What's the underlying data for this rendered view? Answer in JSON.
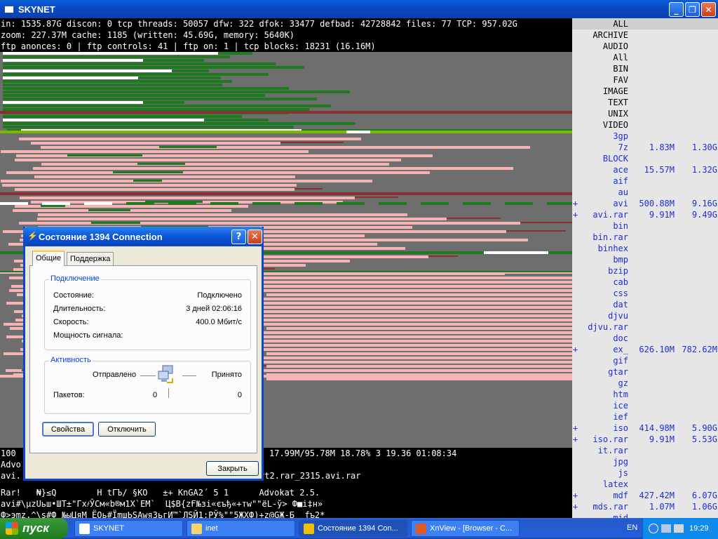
{
  "window": {
    "title": "SKYNET"
  },
  "status": [
    "in: 1535.87G discon: 0 tcp threads: 50057 dfw: 322 dfok: 33477 defbad: 42728842 files: 77 TCP: 957.02G",
    "zoom: 227.37M cache: 1185 (written: 45.69G, memory: 5640K)",
    "ftp anonces: 0 | ftp controls: 41 | ftp on: 1 | tcp blocks: 18231 (16.16M)"
  ],
  "panel": [
    {
      "name": "ALL",
      "kind": "cat",
      "hl": true
    },
    {
      "name": "ARCHIVE",
      "kind": "cat"
    },
    {
      "name": "AUDIO",
      "kind": "cat"
    },
    {
      "name": "All",
      "kind": "cat"
    },
    {
      "name": "BIN",
      "kind": "cat"
    },
    {
      "name": "FAV",
      "kind": "cat"
    },
    {
      "name": "IMAGE",
      "kind": "cat"
    },
    {
      "name": "TEXT",
      "kind": "cat"
    },
    {
      "name": "UNIX",
      "kind": "cat"
    },
    {
      "name": "VIDEO",
      "kind": "cat"
    },
    {
      "name": "3gp",
      "kind": "ext"
    },
    {
      "name": "7z",
      "kind": "ext",
      "s1": "1.83M",
      "s2": "1.30G"
    },
    {
      "name": "BLOCK",
      "kind": "ext"
    },
    {
      "name": "ace",
      "kind": "ext",
      "s1": "15.57M",
      "s2": "1.32G"
    },
    {
      "name": "aif",
      "kind": "ext"
    },
    {
      "name": "au",
      "kind": "ext"
    },
    {
      "name": "avi",
      "kind": "ext",
      "plus": "+",
      "s1": "500.88M",
      "s2": "9.16G"
    },
    {
      "name": "avi.rar",
      "kind": "ext",
      "plus": "+",
      "s1": "9.91M",
      "s2": "9.49G"
    },
    {
      "name": "bin",
      "kind": "ext"
    },
    {
      "name": "bin.rar",
      "kind": "ext"
    },
    {
      "name": "binhex",
      "kind": "ext"
    },
    {
      "name": "bmp",
      "kind": "ext"
    },
    {
      "name": "bzip",
      "kind": "ext"
    },
    {
      "name": "cab",
      "kind": "ext"
    },
    {
      "name": "css",
      "kind": "ext"
    },
    {
      "name": "dat",
      "kind": "ext"
    },
    {
      "name": "djvu",
      "kind": "ext"
    },
    {
      "name": "djvu.rar",
      "kind": "ext"
    },
    {
      "name": "doc",
      "kind": "ext"
    },
    {
      "name": "ex_",
      "kind": "ext",
      "plus": "+",
      "s1": "626.10M",
      "s2": "782.62M"
    },
    {
      "name": "gif",
      "kind": "ext"
    },
    {
      "name": "gtar",
      "kind": "ext"
    },
    {
      "name": "gz",
      "kind": "ext"
    },
    {
      "name": "htm",
      "kind": "ext"
    },
    {
      "name": "ice",
      "kind": "ext"
    },
    {
      "name": "ief",
      "kind": "ext"
    },
    {
      "name": "iso",
      "kind": "ext",
      "plus": "+",
      "s1": "414.98M",
      "s2": "5.90G"
    },
    {
      "name": "iso.rar",
      "kind": "ext",
      "plus": "+",
      "s1": "9.91M",
      "s2": "5.53G"
    },
    {
      "name": "it.rar",
      "kind": "ext"
    },
    {
      "name": "jpg",
      "kind": "ext"
    },
    {
      "name": "js",
      "kind": "ext"
    },
    {
      "name": "latex",
      "kind": "ext"
    },
    {
      "name": "mdf",
      "kind": "ext",
      "plus": "+",
      "s1": "427.42M",
      "s2": "6.07G"
    },
    {
      "name": "mds.rar",
      "kind": "ext",
      "plus": "+",
      "s1": "1.07M",
      "s2": "1.06G"
    },
    {
      "name": "mid",
      "kind": "ext"
    }
  ],
  "console": {
    "line1_left": "100",
    "line1_right": "17.99M/95.78M 18.78% 3 19.36 01:08:34",
    "line2": "Advo",
    "line3_left": "avi.",
    "line3_right": "rt2.rar_2315.avi.rar",
    "line4": "Rar!   ₦}≤Q        H tГЪ/ §KO   ±+ KnGA2´ 5 1      Advokat 2.5.",
    "line5": "avi#\\µzUьш•ШТ±\"Гх҂ЎСм«b®м1X`ЕМ`  Ц$В{zҒ№зі«єъђ«+тw\"\"ёL-ў> Ф■і‡н»",
    "line6": "Ф>эmz.^\\s#Ф №ыЦяМ ЁОь#ЇmшЬSАwяЗьгИ™`ЛSЙ1:РЎ%\"\"5ЖХФ)+z@GЖ-Б  fъ2*"
  },
  "dialog": {
    "title": "Состояние 1394 Connection",
    "tabs": [
      "Общие",
      "Поддержка"
    ],
    "connection_group": "Подключение",
    "rows": [
      {
        "label": "Состояние:",
        "value": "Подключено"
      },
      {
        "label": "Длительность:",
        "value": "3 дней 02:06:16"
      },
      {
        "label": "Скорость:",
        "value": "400.0 Мбит/с"
      },
      {
        "label": "Мощность сигнала:",
        "value": ""
      }
    ],
    "activity_group": "Активность",
    "sent_label": "Отправлено",
    "received_label": "Принято",
    "packets_label": "Пакетов:",
    "packets_sent": "0",
    "packets_received": "0",
    "properties_button": "Свойства",
    "disconnect_button": "Отключить",
    "close_button": "Закрыть"
  },
  "taskbar": {
    "start": "пуск",
    "items": [
      {
        "label": "SKYNET",
        "icon": "app-window-icon",
        "color": "#ffffff"
      },
      {
        "label": "inet",
        "icon": "folder-icon",
        "color": "#f6d46b"
      },
      {
        "label": "Состояние 1394 Con...",
        "icon": "network-icon",
        "color": "#f0c000",
        "active": true
      },
      {
        "label": "XnView - [Browser - C...",
        "icon": "xnview-icon",
        "color": "#e05a28"
      }
    ],
    "lang": "EN",
    "time": "19:29"
  },
  "colors": {
    "green": "#1f7a1f",
    "lightgreen": "#7ab800",
    "pink": "#f4b4b4",
    "darkred": "#8a3030",
    "white": "#ffffff",
    "grey": "#6e6e6e"
  }
}
